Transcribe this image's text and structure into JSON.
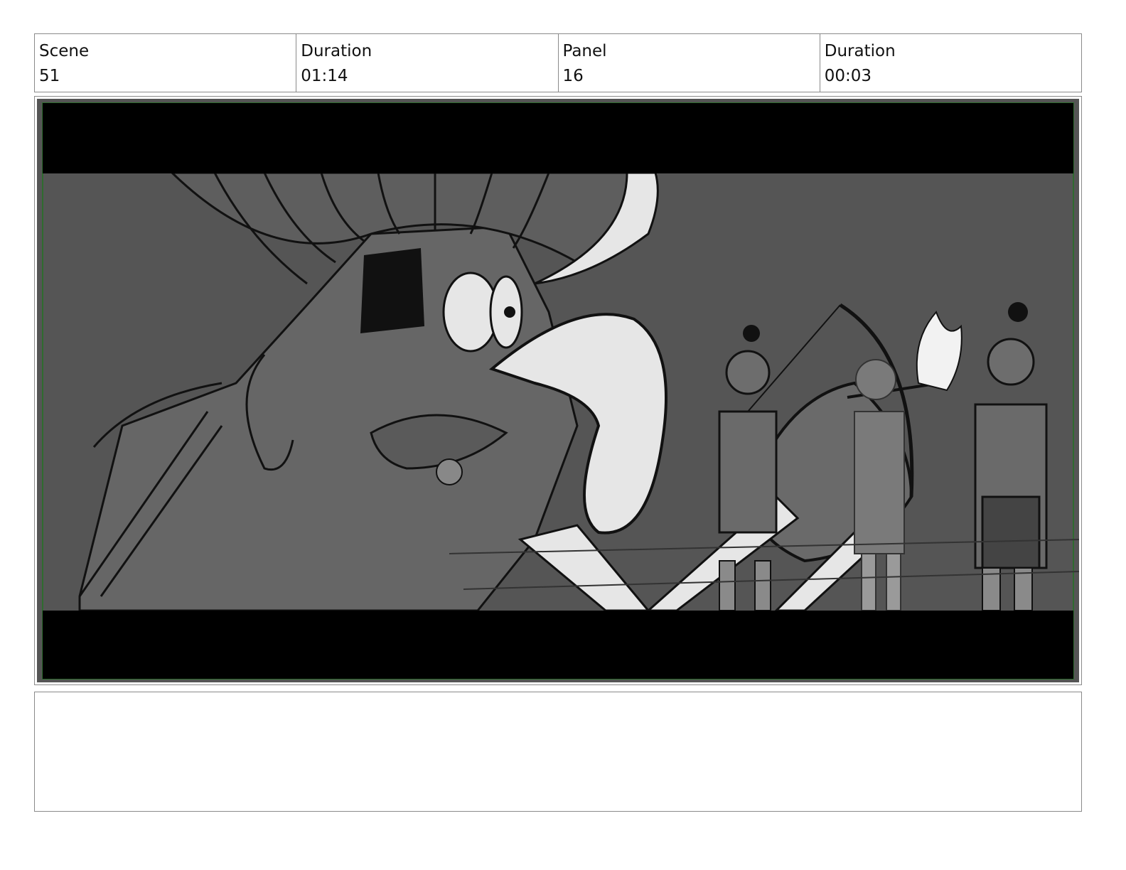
{
  "header": {
    "scene_label": "Scene",
    "scene_value": "51",
    "scene_duration_label": "Duration",
    "scene_duration_value": "01:14",
    "panel_label": "Panel",
    "panel_value": "16",
    "panel_duration_label": "Duration",
    "panel_duration_value": "00:03"
  },
  "panel": {
    "image_description_name": "storyboard-sketch"
  },
  "notes": {
    "text": ""
  },
  "colors": {
    "border": "#8a8a8a",
    "frame_green": "#2f6b2f",
    "letterbox": "#000000",
    "sketch_bg": "#555555",
    "sketch_mid": "#666666",
    "sketch_light": "#e6e6e6"
  }
}
